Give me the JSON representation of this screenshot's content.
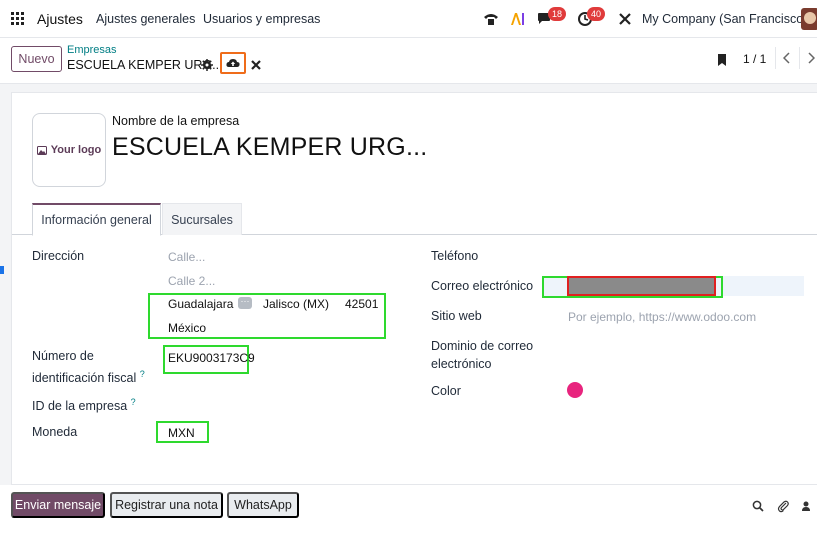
{
  "navbar": {
    "app_title": "Ajustes",
    "menu": [
      "Ajustes generales",
      "Usuarios y empresas"
    ],
    "messages_count": "18",
    "activities_count": "40",
    "company": "My Company (San Francisco)"
  },
  "control": {
    "new_label": "Nuevo",
    "breadcrumb": "Empresas",
    "record_name": "ESCUELA KEMPER URG...",
    "pager": "1 / 1"
  },
  "form": {
    "logo_text": "Your logo",
    "name_label": "Nombre de la empresa",
    "name_value": "ESCUELA KEMPER URG...",
    "tabs": [
      "Información general",
      "Sucursales"
    ],
    "address_label": "Dirección",
    "street_placeholder": "Calle...",
    "street2_placeholder": "Calle 2...",
    "city": "Guadalajara",
    "state": "Jalisco (MX)",
    "zip": "42501",
    "country": "México",
    "vat_label_line1": "Número de",
    "vat_label_line2": "identificación fiscal",
    "vat_value": "EKU9003173C9",
    "company_id_label": "ID de la empresa",
    "currency_label": "Moneda",
    "currency_value": "MXN",
    "phone_label": "Teléfono",
    "email_label": "Correo electrónico",
    "website_label": "Sitio web",
    "website_placeholder": "Por ejemplo, https://www.odoo.com",
    "email_domain_label_line1": "Dominio de correo",
    "email_domain_label_line2": "electrónico",
    "color_label": "Color",
    "color_value": "#e8247e",
    "tooltip_mark": "?"
  },
  "chatter": {
    "send_message": "Enviar mensaje",
    "log_note": "Registrar una nota",
    "whatsapp": "WhatsApp"
  },
  "colors": {
    "primary": "#714b67",
    "accent": "#017e84",
    "highlight_green": "#2ed92e",
    "highlight_red": "#e02020",
    "highlight_orange": "#ef6c1a"
  }
}
